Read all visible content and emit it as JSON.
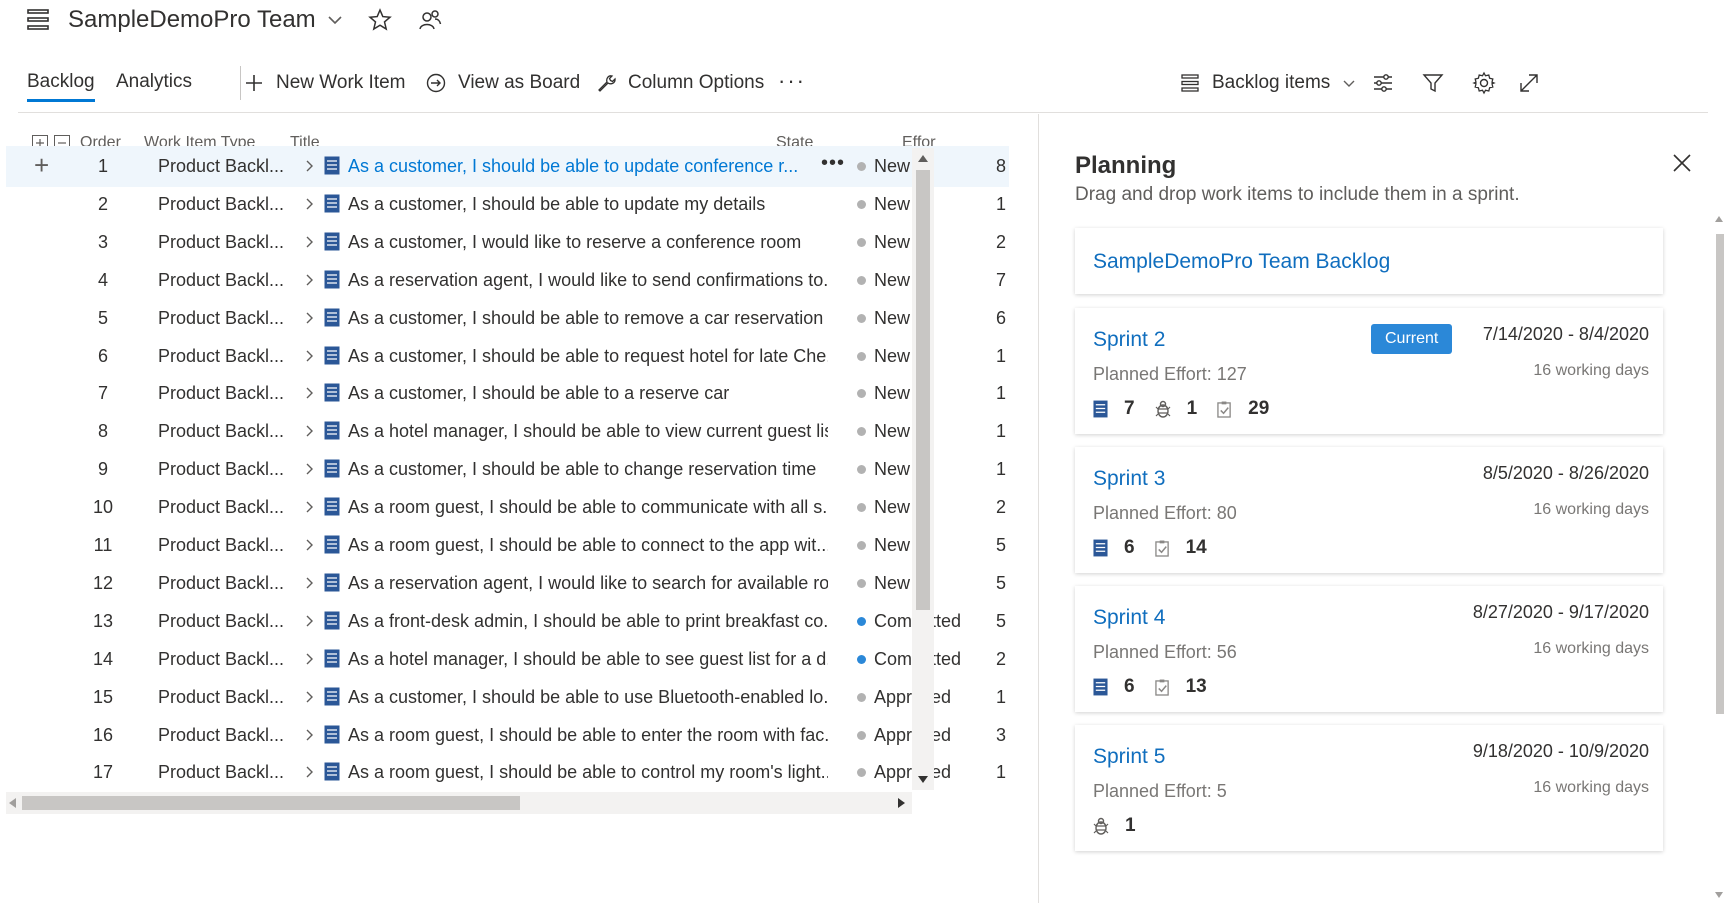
{
  "header": {
    "team_name": "SampleDemoPro Team"
  },
  "toolbar": {
    "tabs": [
      {
        "label": "Backlog",
        "active": true
      },
      {
        "label": "Analytics",
        "active": false
      }
    ],
    "new_work_item": "New Work Item",
    "view_as_board": "View as Board",
    "column_options": "Column Options",
    "more": "···",
    "backlog_level": "Backlog items"
  },
  "grid": {
    "columns": {
      "order": "Order",
      "type": "Work Item Type",
      "title": "Title",
      "state": "State",
      "effort": "Effort"
    },
    "rows": [
      {
        "order": "1",
        "type": "Product Backl...",
        "title": "As a customer, I should be able to update conference r...",
        "state": "New",
        "effort": "8"
      },
      {
        "order": "2",
        "type": "Product Backl...",
        "title": "As a customer, I should be able to update my details",
        "state": "New",
        "effort": "1"
      },
      {
        "order": "3",
        "type": "Product Backl...",
        "title": "As a customer, I would like to reserve a conference room",
        "state": "New",
        "effort": "2"
      },
      {
        "order": "4",
        "type": "Product Backl...",
        "title": "As a reservation agent, I would like to send confirmations to...",
        "state": "New",
        "effort": "7"
      },
      {
        "order": "5",
        "type": "Product Backl...",
        "title": "As a customer, I should be able to remove a car reservation",
        "state": "New",
        "effort": "6"
      },
      {
        "order": "6",
        "type": "Product Backl...",
        "title": "As a customer, I should be able to request hotel for late Che...",
        "state": "New",
        "effort": "1"
      },
      {
        "order": "7",
        "type": "Product Backl...",
        "title": "As a customer, I should be able to a reserve car",
        "state": "New",
        "effort": "1"
      },
      {
        "order": "8",
        "type": "Product Backl...",
        "title": "As a hotel manager, I should be able to view current guest list",
        "state": "New",
        "effort": "1"
      },
      {
        "order": "9",
        "type": "Product Backl...",
        "title": "As a customer, I should be able to change reservation time",
        "state": "New",
        "effort": "1"
      },
      {
        "order": "10",
        "type": "Product Backl...",
        "title": "As a room guest, I should be able to communicate with all s...",
        "state": "New",
        "effort": "2"
      },
      {
        "order": "11",
        "type": "Product Backl...",
        "title": "As a room guest, I should be able to connect to the app wit...",
        "state": "New",
        "effort": "5"
      },
      {
        "order": "12",
        "type": "Product Backl...",
        "title": "As a reservation agent, I would like to search for available ro...",
        "state": "New",
        "effort": "5"
      },
      {
        "order": "13",
        "type": "Product Backl...",
        "title": "As a front-desk admin, I should be able to print breakfast co...",
        "state": "Committed",
        "effort": "5"
      },
      {
        "order": "14",
        "type": "Product Backl...",
        "title": "As a hotel manager, I should be able to see guest list for a d...",
        "state": "Committed",
        "effort": "2"
      },
      {
        "order": "15",
        "type": "Product Backl...",
        "title": "As a customer, I should be able to use Bluetooth-enabled lo...",
        "state": "Approved",
        "effort": "1"
      },
      {
        "order": "16",
        "type": "Product Backl...",
        "title": "As a room guest, I should be able to enter the room with fac...",
        "state": "Approved",
        "effort": "3"
      },
      {
        "order": "17",
        "type": "Product Backl...",
        "title": "As a room guest, I should be able to control my room's light...",
        "state": "Approved",
        "effort": "1"
      }
    ]
  },
  "planning": {
    "title": "Planning",
    "subtitle": "Drag and drop work items to include them in a sprint.",
    "backlog_card": "SampleDemoPro Team Backlog",
    "sprints": [
      {
        "name": "Sprint 2",
        "badge": "Current",
        "dates": "7/14/2020 - 8/4/2020",
        "effort": "Planned Effort: 127",
        "days": "16 working days",
        "counts": [
          {
            "icon": "product-backlog-item-icon",
            "value": "7"
          },
          {
            "icon": "bug-icon",
            "value": "1"
          },
          {
            "icon": "task-icon",
            "value": "29"
          }
        ]
      },
      {
        "name": "Sprint 3",
        "badge": "",
        "dates": "8/5/2020 - 8/26/2020",
        "effort": "Planned Effort: 80",
        "days": "16 working days",
        "counts": [
          {
            "icon": "product-backlog-item-icon",
            "value": "6"
          },
          {
            "icon": "task-icon",
            "value": "14"
          }
        ]
      },
      {
        "name": "Sprint 4",
        "badge": "",
        "dates": "8/27/2020 - 9/17/2020",
        "effort": "Planned Effort: 56",
        "days": "16 working days",
        "counts": [
          {
            "icon": "product-backlog-item-icon",
            "value": "6"
          },
          {
            "icon": "task-icon",
            "value": "13"
          }
        ]
      },
      {
        "name": "Sprint 5",
        "badge": "",
        "dates": "9/18/2020 - 10/9/2020",
        "effort": "Planned Effort: 5",
        "days": "16 working days",
        "counts": [
          {
            "icon": "bug-icon",
            "value": "1"
          }
        ]
      }
    ]
  },
  "colors": {
    "accent": "#0078d4",
    "link": "#106ebe",
    "badge": "#2b88d8",
    "state_new": "#b2b2b2",
    "state_committed": "#2b88d8",
    "state_approved": "#b2b2b2",
    "pbi_icon": "#2b5797"
  }
}
